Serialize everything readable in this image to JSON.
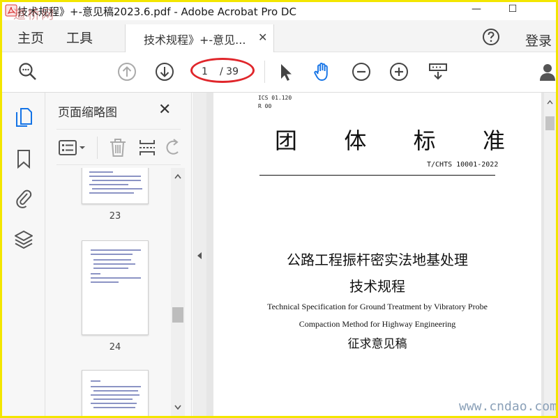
{
  "window": {
    "title": "技术规程》+-意见稿2023.6.pdf - Adobe Acrobat Pro DC",
    "minimize": "—",
    "maximize": "☐"
  },
  "tabbar": {
    "home": "主页",
    "tools": "工具",
    "doc_tab": "技术规程》+-意见...",
    "doc_tab_close": "✕",
    "login": "登录"
  },
  "toolbar": {
    "page_current": "1",
    "page_total": "/ 39"
  },
  "thumbnails": {
    "title": "页面缩略图",
    "close": "✕",
    "pages": [
      {
        "number": "23"
      },
      {
        "number": "24"
      }
    ]
  },
  "document": {
    "ics": "ICS 01.120",
    "r_code": "R 00",
    "heading_chars": [
      "团",
      "体",
      "标",
      "准"
    ],
    "std_number": "T/CHTS 10001-2022",
    "title_cn_line1": "公路工程振杆密实法地基处理",
    "title_cn_line2": "技术规程",
    "title_en_line1": "Technical Specification for Ground Treatment by Vibratory Probe",
    "title_en_line2": "Compaction Method for Highway Engineering",
    "draft_label": "征求意见稿"
  },
  "watermarks": {
    "top_left": "道桥网",
    "bottom_right": "www.cndao.com"
  },
  "colors": {
    "highlight_oval": "#e0262b",
    "frame_border": "#f3e600",
    "hand_tool_active": "#1473e6",
    "sidebar_active": "#1473e6"
  }
}
